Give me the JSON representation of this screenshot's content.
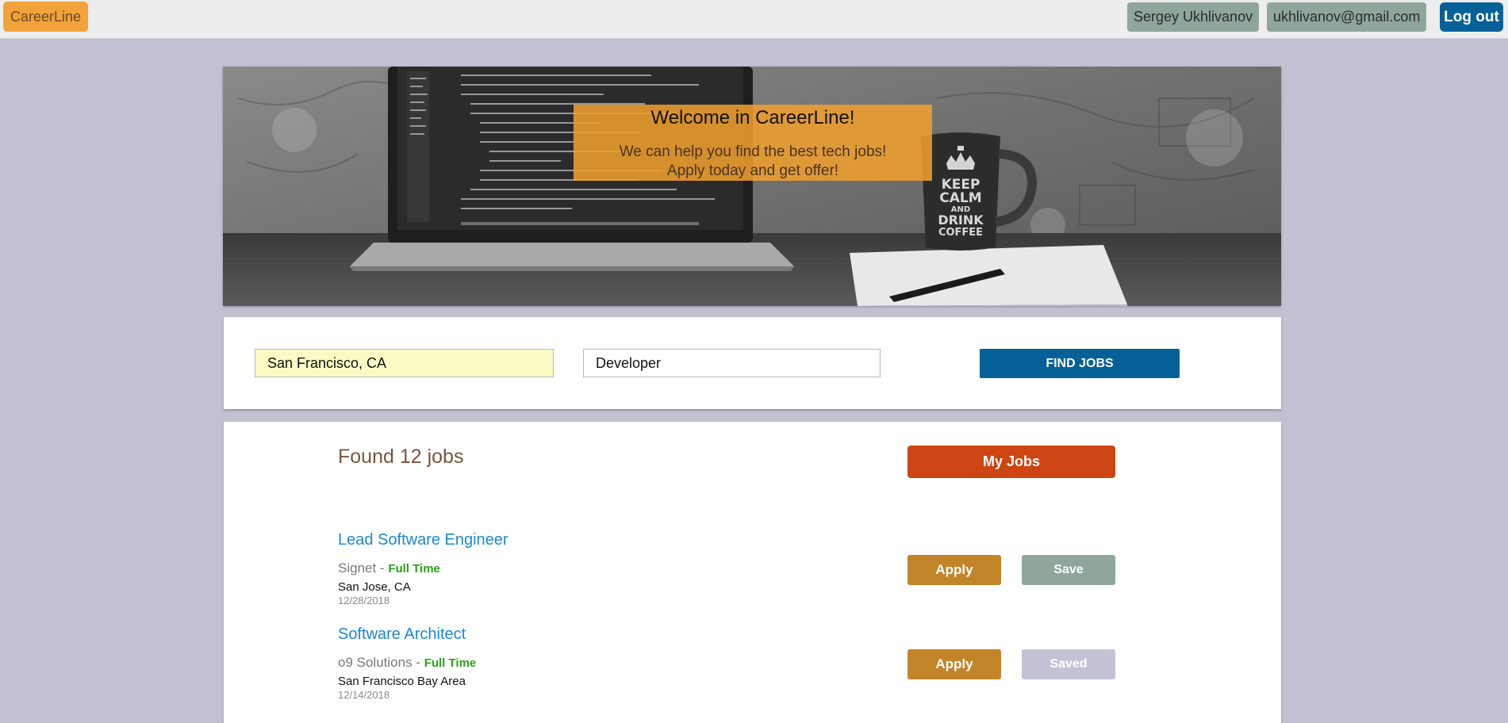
{
  "topbar": {
    "brand": "CareerLine",
    "user_name": "Sergey Ukhlivanov",
    "user_email": "ukhlivanov@gmail.com",
    "logout_label": "Log out"
  },
  "hero": {
    "title": "Welcome in CareerLine!",
    "line1": "We can help you find the best tech jobs!",
    "line2": "Apply today and get offer!",
    "mug_text": [
      "KEEP",
      "CALM",
      "AND",
      "DRINK",
      "COFFEE"
    ]
  },
  "search": {
    "location_value": "San Francisco, CA",
    "keyword_value": "Developer",
    "find_label": "FIND JOBS"
  },
  "results": {
    "found_text": "Found 12 jobs",
    "my_jobs_label": "My Jobs",
    "jobs": [
      {
        "title": "Lead Software Engineer",
        "company": "Signet",
        "separator": " - ",
        "type": "Full Time",
        "location": "San Jose, CA",
        "date": "12/28/2018",
        "apply_label": "Apply",
        "save_label": "Save"
      },
      {
        "title": "Software Architect",
        "company": "o9 Solutions",
        "separator": " - ",
        "type": "Full Time",
        "location": "San Francisco Bay Area",
        "date": "12/14/2018",
        "apply_label": "Apply",
        "save_label": "Saved"
      }
    ]
  },
  "colors": {
    "page_bg": "#c2c1d2",
    "brand": "#f2a23a",
    "primary": "#046097",
    "my_jobs": "#cc4513",
    "apply": "#c28429",
    "save": "#8fa79b",
    "saved": "#c3c2d6",
    "job_title": "#1d88d4",
    "job_type": "#2aa11a"
  }
}
